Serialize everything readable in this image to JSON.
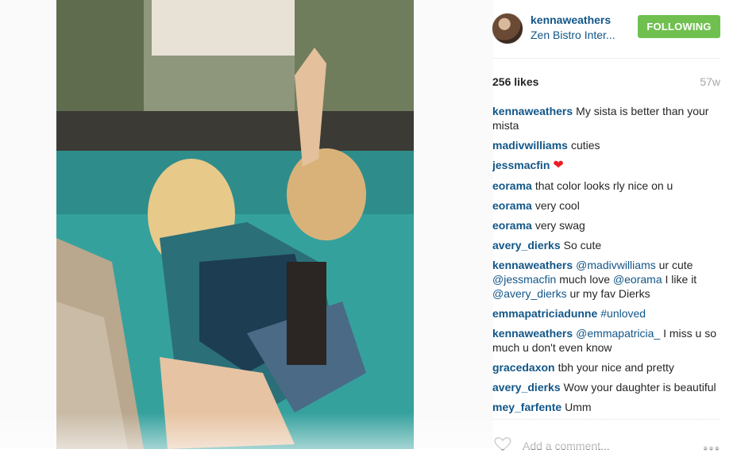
{
  "post": {
    "photo_alt": "",
    "header": {
      "username": "kennaweathers",
      "location": "Zen Bistro Inter...",
      "follow_label": "FOLLOWING"
    },
    "stats": {
      "likes": "256 likes",
      "age": "57w"
    },
    "comments": [
      {
        "author": "kennaweathers",
        "parts": [
          {
            "t": "text",
            "v": "My sista is better than your mista"
          }
        ]
      },
      {
        "author": "madivwilliams",
        "parts": [
          {
            "t": "text",
            "v": "cuties"
          }
        ]
      },
      {
        "author": "jessmacfin",
        "parts": [
          {
            "t": "emoji",
            "v": "❤"
          }
        ]
      },
      {
        "author": "eorama",
        "parts": [
          {
            "t": "text",
            "v": "that color looks rly nice on u"
          }
        ]
      },
      {
        "author": "eorama",
        "parts": [
          {
            "t": "text",
            "v": "very cool"
          }
        ]
      },
      {
        "author": "eorama",
        "parts": [
          {
            "t": "text",
            "v": "very swag"
          }
        ]
      },
      {
        "author": "avery_dierks",
        "parts": [
          {
            "t": "text",
            "v": "So cute"
          }
        ]
      },
      {
        "author": "kennaweathers",
        "parts": [
          {
            "t": "mention",
            "v": "@madivwilliams"
          },
          {
            "t": "text",
            "v": " ur cute "
          },
          {
            "t": "mention",
            "v": "@jessmacfin"
          },
          {
            "t": "text",
            "v": " much love "
          },
          {
            "t": "mention",
            "v": "@eorama"
          },
          {
            "t": "text",
            "v": " I like it "
          },
          {
            "t": "mention",
            "v": "@avery_dierks"
          },
          {
            "t": "text",
            "v": " ur my fav Dierks"
          }
        ]
      },
      {
        "author": "emmapatriciadunne",
        "parts": [
          {
            "t": "mention",
            "v": "#unloved"
          }
        ]
      },
      {
        "author": "kennaweathers",
        "parts": [
          {
            "t": "mention",
            "v": "@emmapatricia_"
          },
          {
            "t": "text",
            "v": " I miss u so much u don't even know"
          }
        ]
      },
      {
        "author": "gracedaxon",
        "parts": [
          {
            "t": "text",
            "v": "tbh your nice and pretty"
          }
        ]
      },
      {
        "author": "avery_dierks",
        "parts": [
          {
            "t": "text",
            "v": "Wow your daughter is beautiful"
          }
        ]
      },
      {
        "author": "mey_farfente",
        "parts": [
          {
            "t": "text",
            "v": "Umm"
          }
        ]
      }
    ],
    "actions": {
      "add_comment_placeholder": "Add a comment...",
      "more_label": "•••"
    }
  },
  "colors": {
    "link": "#125688",
    "follow_bg": "#70c050",
    "heart_emoji": "#ed1c24",
    "muted": "#a5a7aa"
  },
  "icons": [
    "heart-outline-icon",
    "more-options-icon"
  ]
}
